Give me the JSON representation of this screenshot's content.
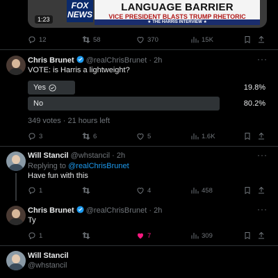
{
  "video": {
    "headline": "LANGUAGE BARRIER",
    "subheadline": "VICE PRESIDENT BLASTS TRUMP RHETORIC",
    "strip": "★ THE HARRIS INTERVIEW ★",
    "logo": "FOX NEWS",
    "duration": "1:23"
  },
  "tweet0": {
    "replies": "12",
    "retweets": "58",
    "likes": "370",
    "views": "15K"
  },
  "tweet1": {
    "name": "Chris Brunet",
    "handle": "@realChrisBrunet",
    "time": "· 2h",
    "text": "VOTE: is Harris a lightweight?",
    "poll": [
      {
        "label": "Yes",
        "percent": "19.8%",
        "share": 0.198
      },
      {
        "label": "No",
        "percent": "80.2%",
        "share": 0.802
      }
    ],
    "poll_meta": "349 votes · 21 hours left",
    "replies": "3",
    "retweets": "6",
    "likes": "5",
    "views": "1.6K"
  },
  "tweet2": {
    "name": "Will Stancil",
    "handle": "@whstancil",
    "time": "· 2h",
    "replying_prefix": "Replying to",
    "replying_to": "@realChrisBrunet",
    "text": "Have fun with this",
    "replies": "1",
    "retweets": "",
    "likes": "4",
    "views": "458"
  },
  "tweet3": {
    "name": "Chris Brunet",
    "handle": "@realChrisBrunet",
    "time": "· 2h",
    "text": "Ty",
    "replies": "1",
    "retweets": "",
    "likes": "7",
    "views": "309"
  },
  "tweet4": {
    "name": "Will Stancil",
    "handle": "@whstancil"
  },
  "colors": {
    "accent": "#1d9bf0",
    "like": "#f91880",
    "muted": "#71767b",
    "background": "#000000"
  },
  "icons": [
    "reply-icon",
    "retweet-icon",
    "like-icon",
    "views-icon",
    "bookmark-icon",
    "share-icon",
    "verified-icon",
    "check-circle-icon",
    "more-icon"
  ]
}
